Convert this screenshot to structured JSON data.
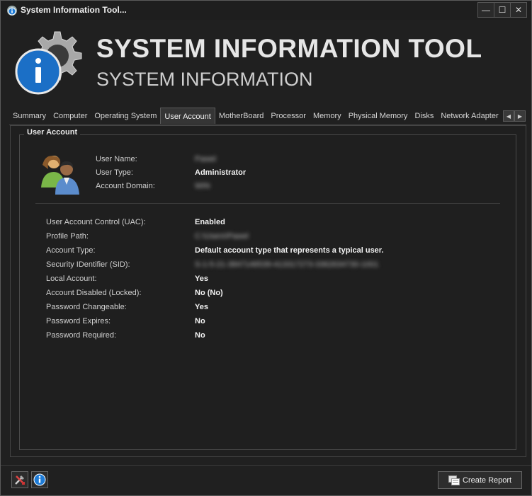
{
  "window": {
    "title": "System Information Tool...",
    "controls": {
      "minimize": "—",
      "maximize": "☐",
      "close": "✕"
    }
  },
  "header": {
    "title": "SYSTEM INFORMATION TOOL",
    "subtitle": "SYSTEM INFORMATION",
    "logo_icon": "gear-info-icon"
  },
  "tabs": [
    {
      "label": "Summary",
      "active": false
    },
    {
      "label": "Computer",
      "active": false
    },
    {
      "label": "Operating System",
      "active": false
    },
    {
      "label": "User Account",
      "active": true
    },
    {
      "label": "MotherBoard",
      "active": false
    },
    {
      "label": "Processor",
      "active": false
    },
    {
      "label": "Memory",
      "active": false
    },
    {
      "label": "Physical Memory",
      "active": false
    },
    {
      "label": "Disks",
      "active": false
    },
    {
      "label": "Network Adapter",
      "active": false
    }
  ],
  "tab_scroll": {
    "left": "◀",
    "right": "▶"
  },
  "group": {
    "title": "User Account",
    "top_fields": [
      {
        "label": "User Name:",
        "value": "Pawel",
        "obscured": true
      },
      {
        "label": "User Type:",
        "value": "Administrator",
        "obscured": false
      },
      {
        "label": "Account Domain:",
        "value": "WIN",
        "obscured": true
      }
    ],
    "fields": [
      {
        "label": "User Account Control (UAC):",
        "value": "Enabled",
        "obscured": false
      },
      {
        "label": "Profile Path:",
        "value": "C:\\Users\\Pawel",
        "obscured": true
      },
      {
        "label": "Account Type:",
        "value": "Default account type that represents a typical user.",
        "obscured": false
      },
      {
        "label": "Security IDentifier (SID):",
        "value": "S-1-5-21-3847146539-413317273-3362634730-1001",
        "obscured": true
      },
      {
        "label": "Local Account:",
        "value": "Yes",
        "obscured": false
      },
      {
        "label": "Account Disabled (Locked):",
        "value": "No (No)",
        "obscured": false
      },
      {
        "label": "Password Changeable:",
        "value": "Yes",
        "obscured": false
      },
      {
        "label": "Password Expires:",
        "value": "No",
        "obscured": false
      },
      {
        "label": "Password Required:",
        "value": "No",
        "obscured": false
      }
    ]
  },
  "footer": {
    "create_report": "Create Report",
    "report_underline_char": "R"
  },
  "colors": {
    "background": "#202020",
    "accent_blue": "#1e7bd6",
    "text": "#d0d0d0"
  }
}
